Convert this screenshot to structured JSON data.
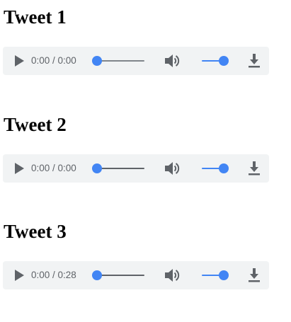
{
  "tweets": [
    {
      "title": "Tweet 1",
      "player": {
        "time": "0:00 / 0:00",
        "progress": 0,
        "volume": 1.0,
        "icons": [
          "play-icon",
          "volume-icon",
          "download-icon"
        ]
      }
    },
    {
      "title": "Tweet 2",
      "player": {
        "time": "0:00 / 0:00",
        "progress": 0,
        "volume": 1.0,
        "icons": [
          "play-icon",
          "volume-icon",
          "download-icon"
        ]
      }
    },
    {
      "title": "Tweet 3",
      "player": {
        "time": "0:00 / 0:28",
        "progress": 0,
        "volume": 1.0,
        "icons": [
          "play-icon",
          "volume-icon",
          "download-icon"
        ]
      }
    }
  ],
  "colors": {
    "player_background": "#f1f3f4",
    "accent": "#4285f4",
    "icon": "#5f6368",
    "heading": "#000000"
  }
}
